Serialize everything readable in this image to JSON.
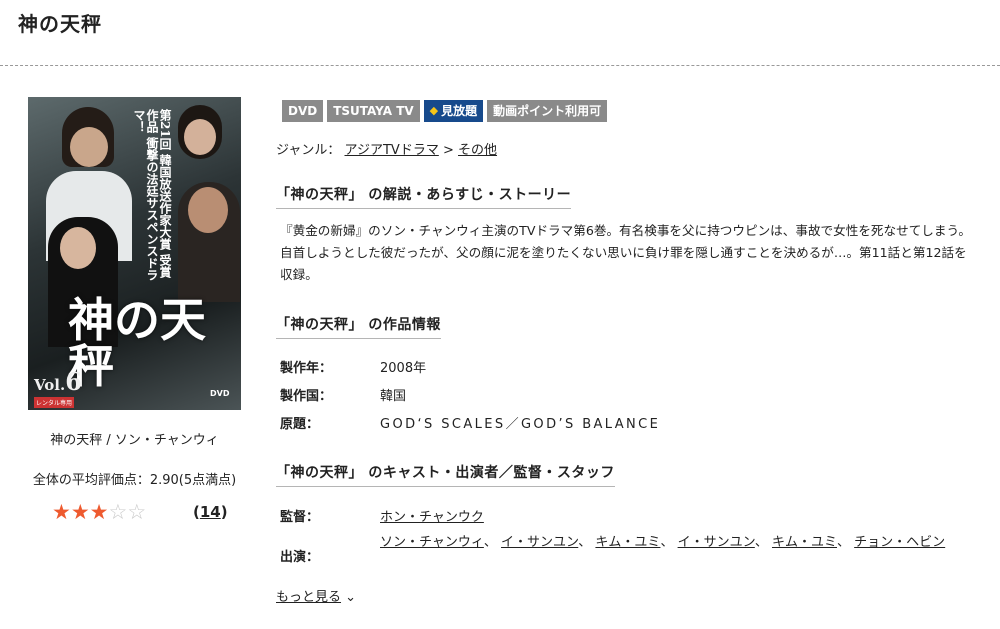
{
  "page": {
    "title": "神の天秤"
  },
  "cover": {
    "big_title": "神の天秤",
    "vol_prefix": "Vol.",
    "vol_number": "6",
    "vertical_text": "第21回 韓国放送作家大賞 受賞作品 衝撃の法廷サスペンスドラマ！",
    "dvd_logo": "DVD",
    "rental_tag": "レンタル専用"
  },
  "caption": "神の天秤 / ソン・チャンウィ",
  "rating": {
    "label": "全体の平均評価点：2.90(5点満点)",
    "value": 2.9,
    "max": 5,
    "stars_filled": 3,
    "count": "14",
    "star_color": "#ee5a2f"
  },
  "badges": [
    {
      "label": "DVD",
      "style": "gray"
    },
    {
      "label": "TSUTAYA TV",
      "style": "gray"
    },
    {
      "label": "見放題",
      "style": "blue",
      "icon": "diamond-icon"
    },
    {
      "label": "動画ポイント利用可",
      "style": "gray"
    }
  ],
  "genre": {
    "label": "ジャンル：",
    "link1": "アジアTVドラマ",
    "separator": ">",
    "link2": "その他"
  },
  "synopsis": {
    "heading": "「神の天秤」 の解説・あらすじ・ストーリー",
    "text": "『黄金の新婦』のソン・チャンウィ主演のTVドラマ第6巻。有名検事を父に持つウピンは、事故で女性を死なせてしまう。自首しようとした彼だったが、父の顔に泥を塗りたくない思いに負け罪を隠し通すことを決めるが…。第11話と第12話を収録。"
  },
  "work_info": {
    "heading": "「神の天秤」 の作品情報",
    "rows": [
      {
        "label": "製作年：",
        "value": "2008年"
      },
      {
        "label": "製作国：",
        "value": "韓国"
      },
      {
        "label": "原題：",
        "value": "GOD‘S SCALES／GOD’S BALANCE"
      }
    ]
  },
  "cast": {
    "heading": "「神の天秤」 のキャスト・出演者／監督・スタッフ",
    "director_label": "監督：",
    "director": "ホン・チャンウク",
    "actors_label": "出演：",
    "actors": [
      "ソン・チャンウィ",
      "イ・サンユン",
      "キム・ユミ",
      "イ・サンユン",
      "キム・ユミ",
      "チョン・ヘビン"
    ],
    "separator": "、"
  },
  "more": {
    "label": "もっと見る"
  }
}
